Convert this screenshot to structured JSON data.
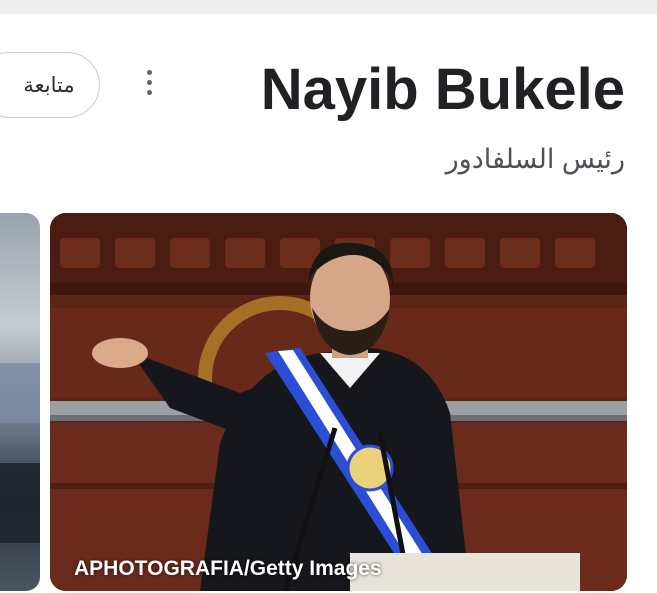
{
  "header": {
    "title": "Nayib Bukele",
    "subtitle": "رئيس السلفادور",
    "follow_label": "متابعة"
  },
  "icons": {
    "more": "more-vert-icon"
  },
  "photo": {
    "credit": "APHOTOGRAFIA/Getty Images"
  },
  "colors": {
    "sash_blue": "#2a4fd6",
    "background_wood": "#5a2418"
  }
}
